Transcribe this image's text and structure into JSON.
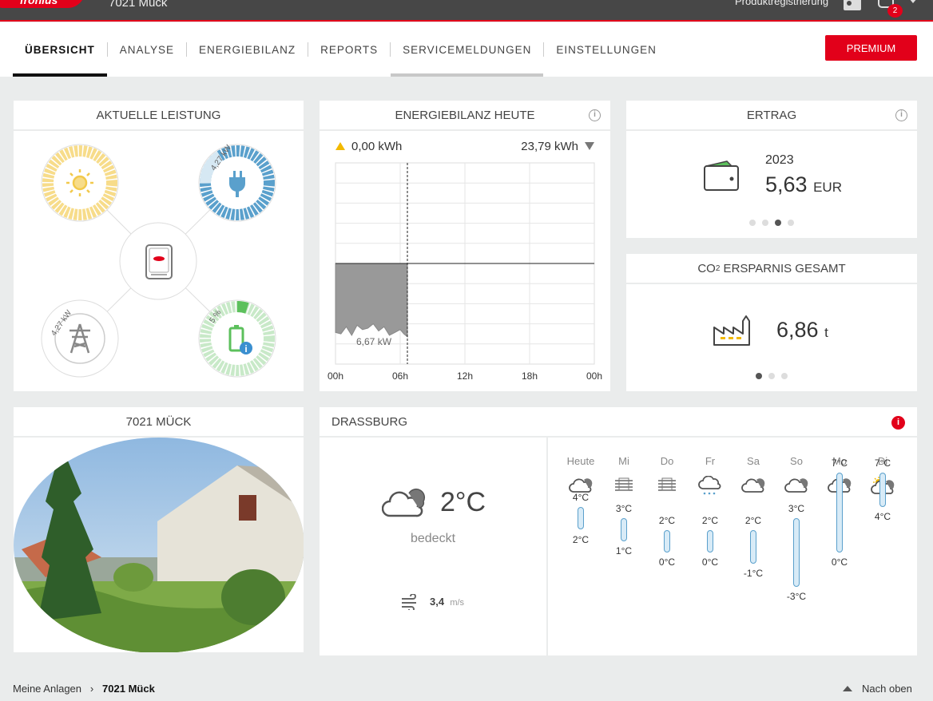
{
  "header": {
    "logo_text": "fronius",
    "plant_name": "7021 Mück",
    "product_registration": "Produktregistrierung",
    "notification_count": "2"
  },
  "nav": {
    "tabs": [
      {
        "label": "ÜBERSICHT"
      },
      {
        "label": "ANALYSE"
      },
      {
        "label": "ENERGIEBILANZ"
      },
      {
        "label": "REPORTS"
      },
      {
        "label": "SERVICEMELDUNGEN"
      },
      {
        "label": "EINSTELLUNGEN"
      }
    ],
    "premium_label": "PREMIUM"
  },
  "power_flow": {
    "title": "AKTUELLE LEISTUNG",
    "load_label": "4,27 kW",
    "grid_label": "4,27 kW",
    "battery_soc_label": "5 %",
    "battery_soc": 0.05
  },
  "energy_balance": {
    "title": "ENERGIEBILANZ HEUTE",
    "produced": "0,00 kWh",
    "consumed": "23,79 kWh",
    "peak_label": "6,67 kW"
  },
  "chart_data": {
    "type": "area",
    "x": [
      "00:00",
      "00:30",
      "01:00",
      "01:30",
      "02:00",
      "02:30",
      "03:00",
      "03:30",
      "04:00",
      "04:30",
      "05:00",
      "05:30",
      "06:00",
      "06:20",
      "06:40"
    ],
    "series": [
      {
        "values": [
          -4.8,
          -4.9,
          -4.4,
          -5.0,
          -4.3,
          -4.6,
          -4.5,
          -4.2,
          -4.7,
          -4.4,
          -5.0,
          -4.8,
          -4.6,
          -4.9,
          -5.1
        ]
      }
    ],
    "xticks": [
      "00h",
      "06h",
      "12h",
      "18h",
      "00h"
    ],
    "ylim": [
      -7,
      7
    ],
    "grid": true
  },
  "ertrag": {
    "title": "ERTRAG",
    "year": "2023",
    "value": "5,63",
    "unit": "EUR"
  },
  "co2": {
    "title_prefix": "CO",
    "title_sub": "2",
    "title_suffix": " ERSPARNIS GESAMT",
    "value": "6,86",
    "unit": "t"
  },
  "photo": {
    "title": "7021 MÜCK"
  },
  "weather": {
    "location": "DRASSBURG",
    "current_temp": "2°C",
    "condition": "bedeckt",
    "wind_value": "3,4",
    "wind_unit": "m/s",
    "days": [
      {
        "name": "Heute",
        "icon": "cloud-icon",
        "max": "4°C",
        "min": "2°C",
        "max_val": 4,
        "min_val": 2
      },
      {
        "name": "Mi",
        "icon": "fog-icon",
        "max": "3°C",
        "min": "1°C",
        "max_val": 3,
        "min_val": 1
      },
      {
        "name": "Do",
        "icon": "fog-icon",
        "max": "2°C",
        "min": "0°C",
        "max_val": 2,
        "min_val": 0
      },
      {
        "name": "Fr",
        "icon": "snow-icon",
        "max": "2°C",
        "min": "0°C",
        "max_val": 2,
        "min_val": 0
      },
      {
        "name": "Sa",
        "icon": "cloud-icon",
        "max": "2°C",
        "min": "-1°C",
        "max_val": 2,
        "min_val": -1
      },
      {
        "name": "So",
        "icon": "cloud-icon",
        "max": "3°C",
        "min": "-3°C",
        "max_val": 3,
        "min_val": -3
      },
      {
        "name": "Mo",
        "icon": "cloud-icon",
        "max": "7°C",
        "min": "0°C",
        "max_val": 7,
        "min_val": 0
      },
      {
        "name": "Di",
        "icon": "sun-cloud-icon",
        "max": "7°C",
        "min": "4°C",
        "max_val": 7,
        "min_val": 4
      }
    ]
  },
  "footer": {
    "breadcrumb_root": "Meine Anlagen",
    "breadcrumb_sep": "›",
    "breadcrumb_current": "7021 Mück",
    "scroll_top": "Nach oben"
  },
  "colors": {
    "accent": "#e2001a",
    "pv": "#f7dc8a",
    "load": "#5aa0cc",
    "battery": "#8fd28f"
  }
}
